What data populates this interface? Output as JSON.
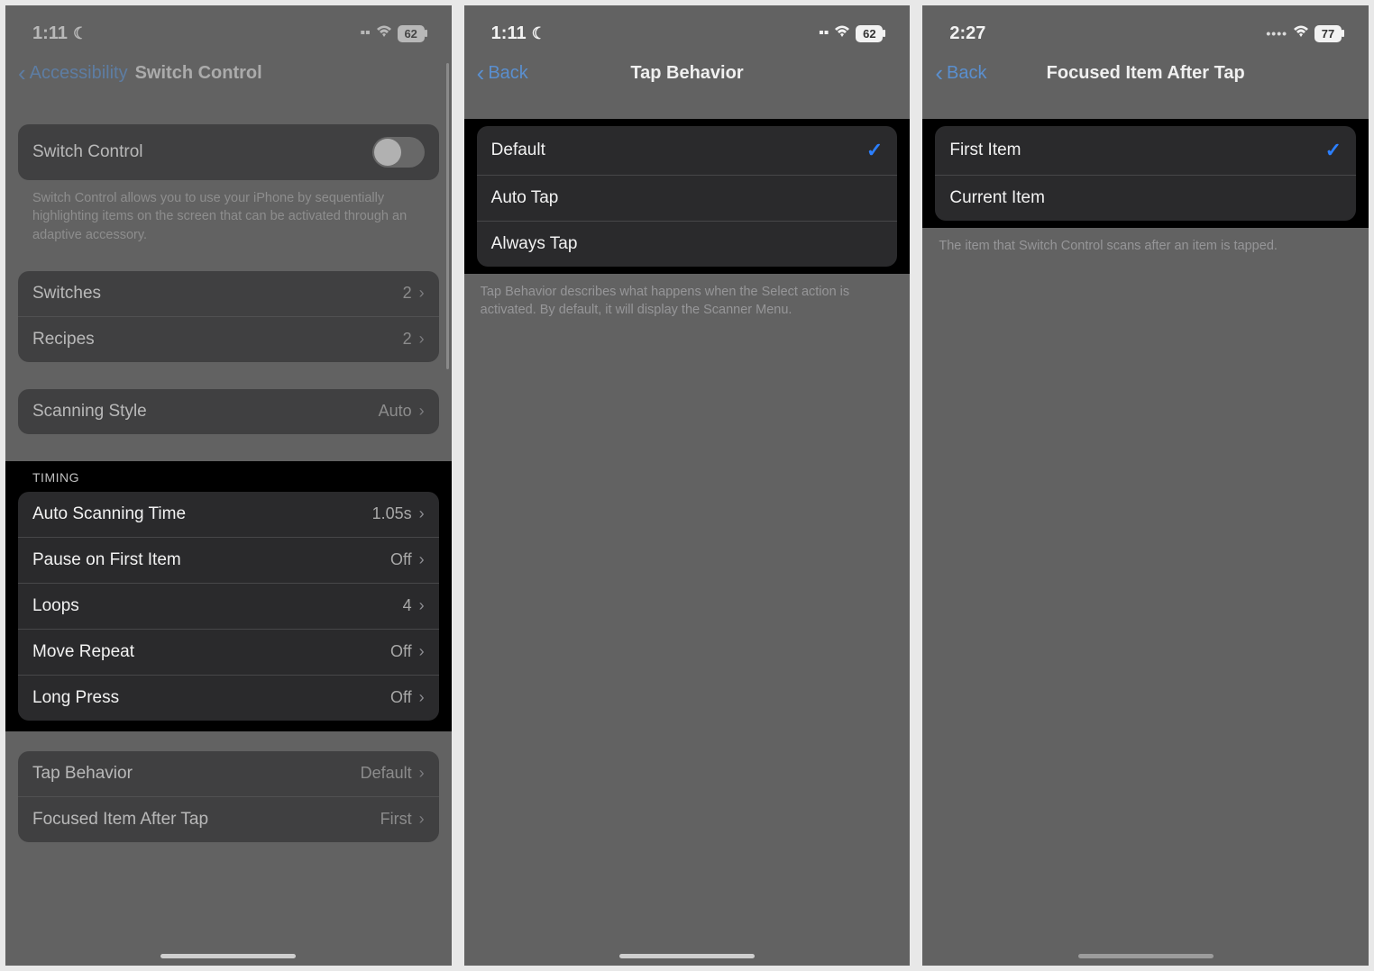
{
  "panel1": {
    "status": {
      "time": "1:11",
      "battery": "62"
    },
    "nav": {
      "back": "Accessibility",
      "title": "Switch Control"
    },
    "toggle": {
      "label": "Switch Control"
    },
    "desc": "Switch Control allows you to use your iPhone by sequentially highlighting items on the screen that can be activated through an adaptive accessory.",
    "switches_row": {
      "label": "Switches",
      "value": "2"
    },
    "recipes_row": {
      "label": "Recipes",
      "value": "2"
    },
    "scanning_row": {
      "label": "Scanning Style",
      "value": "Auto"
    },
    "timing_header": "TIMING",
    "timing": [
      {
        "label": "Auto Scanning Time",
        "value": "1.05s"
      },
      {
        "label": "Pause on First Item",
        "value": "Off"
      },
      {
        "label": "Loops",
        "value": "4"
      },
      {
        "label": "Move Repeat",
        "value": "Off"
      },
      {
        "label": "Long Press",
        "value": "Off"
      }
    ],
    "tap_row": {
      "label": "Tap Behavior",
      "value": "Default"
    },
    "focused_row": {
      "label": "Focused Item After Tap",
      "value": "First"
    }
  },
  "panel2": {
    "status": {
      "time": "1:11",
      "battery": "62"
    },
    "nav": {
      "back": "Back",
      "title": "Tap Behavior"
    },
    "options": [
      {
        "label": "Default",
        "selected": true
      },
      {
        "label": "Auto Tap",
        "selected": false
      },
      {
        "label": "Always Tap",
        "selected": false
      }
    ],
    "footer": "Tap Behavior describes what happens when the Select action is activated. By default, it will display the Scanner Menu."
  },
  "panel3": {
    "status": {
      "time": "2:27",
      "battery": "77"
    },
    "nav": {
      "back": "Back",
      "title": "Focused Item After Tap"
    },
    "options": [
      {
        "label": "First Item",
        "selected": true
      },
      {
        "label": "Current Item",
        "selected": false
      }
    ],
    "footer": "The item that Switch Control scans after an item is tapped."
  }
}
